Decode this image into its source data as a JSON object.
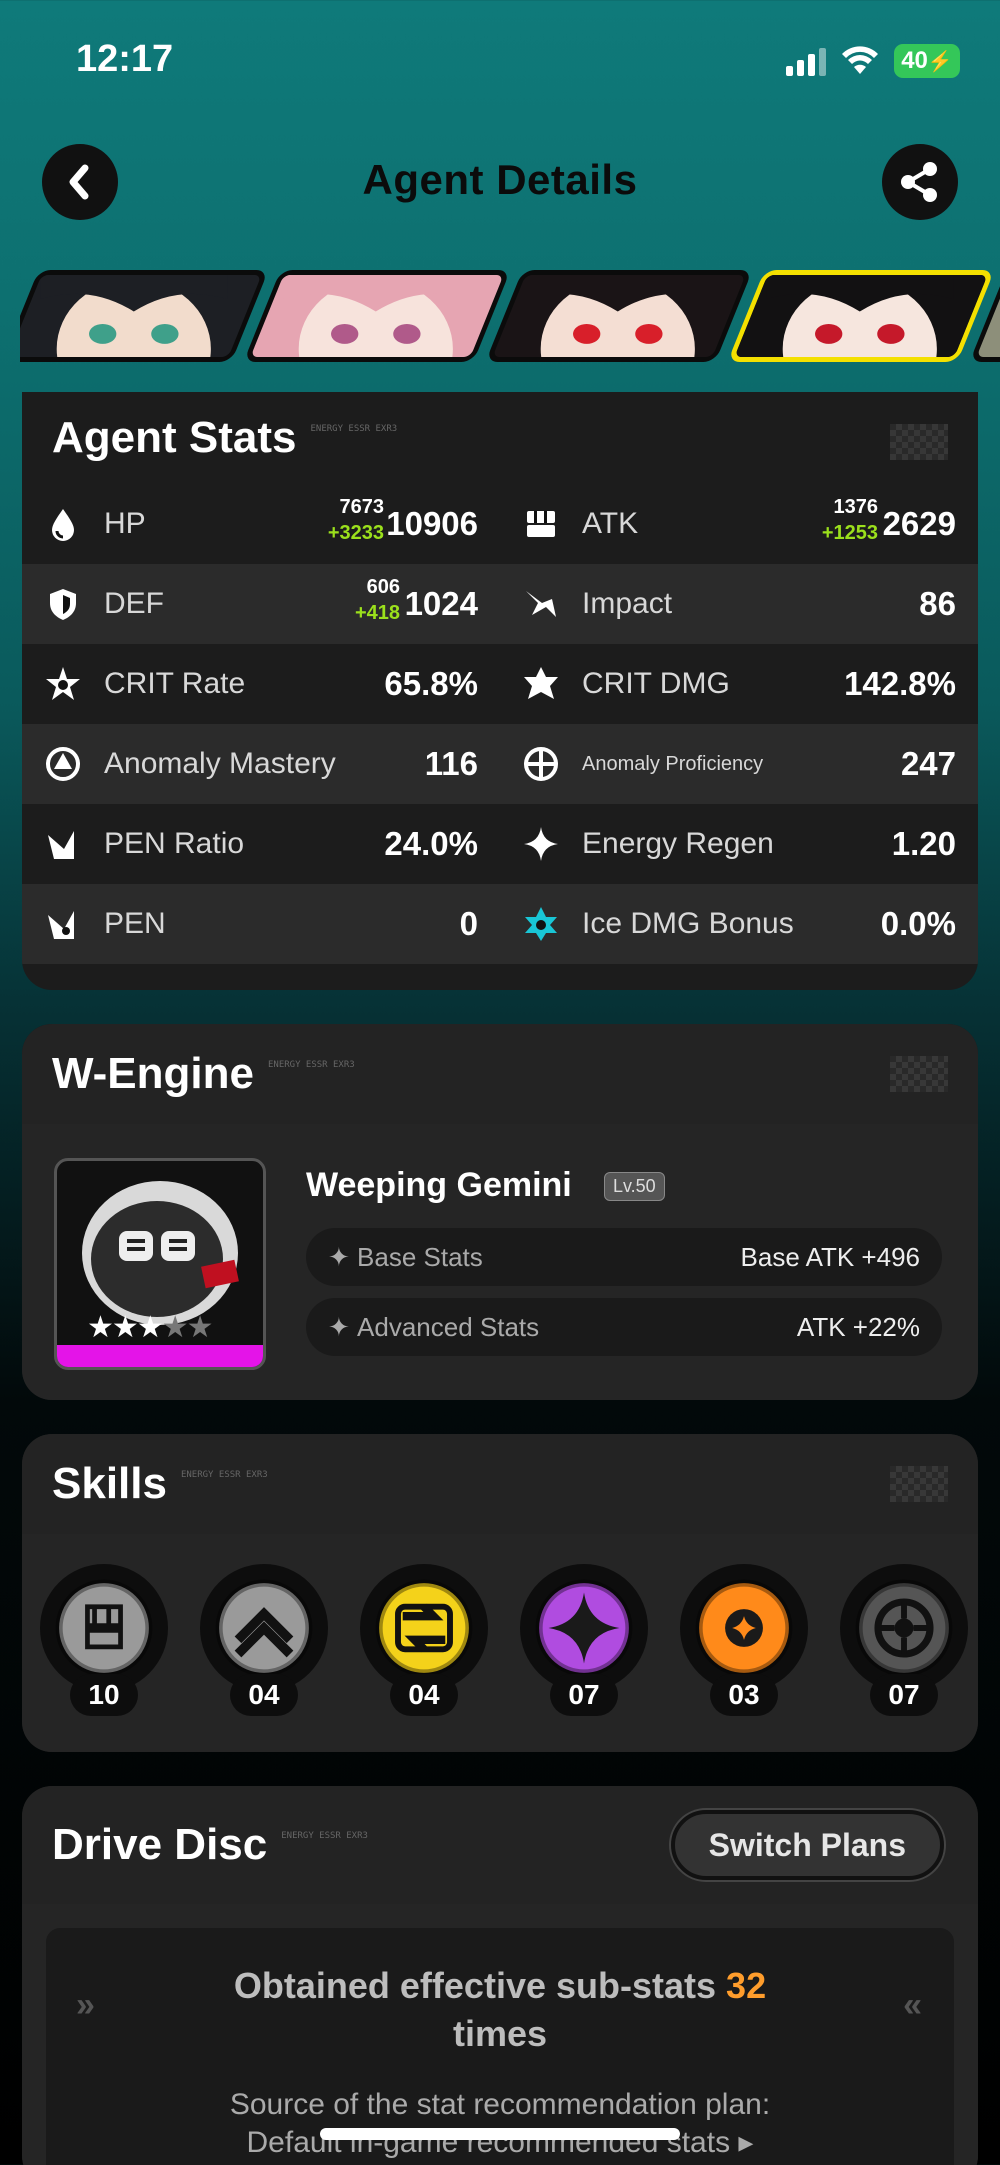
{
  "status_bar": {
    "time": "12:17",
    "battery": "40"
  },
  "header": {
    "title": "Agent Details"
  },
  "agents": [
    {
      "hair": "#1d1f24",
      "skin": "#f2dccc",
      "eye": "#3fa08a",
      "active": false
    },
    {
      "hair": "#e6a5b2",
      "skin": "#f7e3dc",
      "eye": "#b05a8a",
      "active": false
    },
    {
      "hair": "#1a1416",
      "skin": "#f4ded3",
      "eye": "#d81f2a",
      "active": false
    },
    {
      "hair": "#121112",
      "skin": "#f6e6de",
      "eye": "#c5192a",
      "active": true
    },
    {
      "hair": "#8d8f7a",
      "skin": "#e9ddd0",
      "eye": "#777",
      "active": false
    }
  ],
  "stats": {
    "title": "Agent Stats",
    "deco": "ENERGY ESSR EXR3",
    "rows": [
      [
        {
          "icon": "hp-icon",
          "name": "HP",
          "value": "10906",
          "base": "7673",
          "bonus": "+3233"
        },
        {
          "icon": "atk-icon",
          "name": "ATK",
          "value": "2629",
          "base": "1376",
          "bonus": "+1253"
        }
      ],
      [
        {
          "icon": "def-icon",
          "name": "DEF",
          "value": "1024",
          "base": "606",
          "bonus": "+418"
        },
        {
          "icon": "impact-icon",
          "name": "Impact",
          "value": "86"
        }
      ],
      [
        {
          "icon": "crit-rate-icon",
          "name": "CRIT Rate",
          "value": "65.8%"
        },
        {
          "icon": "crit-dmg-icon",
          "name": "CRIT DMG",
          "value": "142.8%"
        }
      ],
      [
        {
          "icon": "anomaly-mastery-icon",
          "name": "Anomaly Mastery",
          "value": "116"
        },
        {
          "icon": "anomaly-proficiency-icon",
          "name": "Anomaly Proficiency",
          "value": "247",
          "small": true
        }
      ],
      [
        {
          "icon": "pen-ratio-icon",
          "name": "PEN Ratio",
          "value": "24.0%"
        },
        {
          "icon": "energy-regen-icon",
          "name": "Energy Regen",
          "value": "1.20"
        }
      ],
      [
        {
          "icon": "pen-icon",
          "name": "PEN",
          "value": "0"
        },
        {
          "icon": "ice-dmg-icon",
          "name": "Ice DMG Bonus",
          "value": "0.0%"
        }
      ]
    ]
  },
  "wengine": {
    "title": "W-Engine",
    "deco": "ENERGY ESSR EXR3",
    "name": "Weeping Gemini",
    "level": "Lv.50",
    "stars_filled": 3,
    "stars_total": 5,
    "base_stats_label": "Base Stats",
    "base_stats_value": "Base ATK +496",
    "advanced_stats_label": "Advanced Stats",
    "advanced_stats_value": "ATK +22%",
    "rarity_color": "#e414e8"
  },
  "skills": {
    "title": "Skills",
    "deco": "ENERGY ESSR EXR3",
    "items": [
      {
        "name": "basic-attack-icon",
        "level": "10",
        "color": "#9a9a9a"
      },
      {
        "name": "dodge-icon",
        "level": "04",
        "color": "#9a9a9a"
      },
      {
        "name": "assist-icon",
        "level": "04",
        "color": "#f4d21a"
      },
      {
        "name": "special-attack-icon",
        "level": "07",
        "color": "#b04ce0"
      },
      {
        "name": "chain-attack-icon",
        "level": "03",
        "color": "#ff8a1a"
      },
      {
        "name": "core-skill-icon",
        "level": "07",
        "color": "#555555"
      }
    ]
  },
  "drive_disc": {
    "title": "Drive Disc",
    "deco": "ENERGY ESSR EXR3",
    "switch_label": "Switch Plans",
    "effective_prefix": "Obtained effective sub-stats",
    "effective_count": "32",
    "effective_suffix": "times",
    "source_line1": "Source of the stat recommendation plan:",
    "source_line2": "Default in-game recommended stats ▸"
  }
}
